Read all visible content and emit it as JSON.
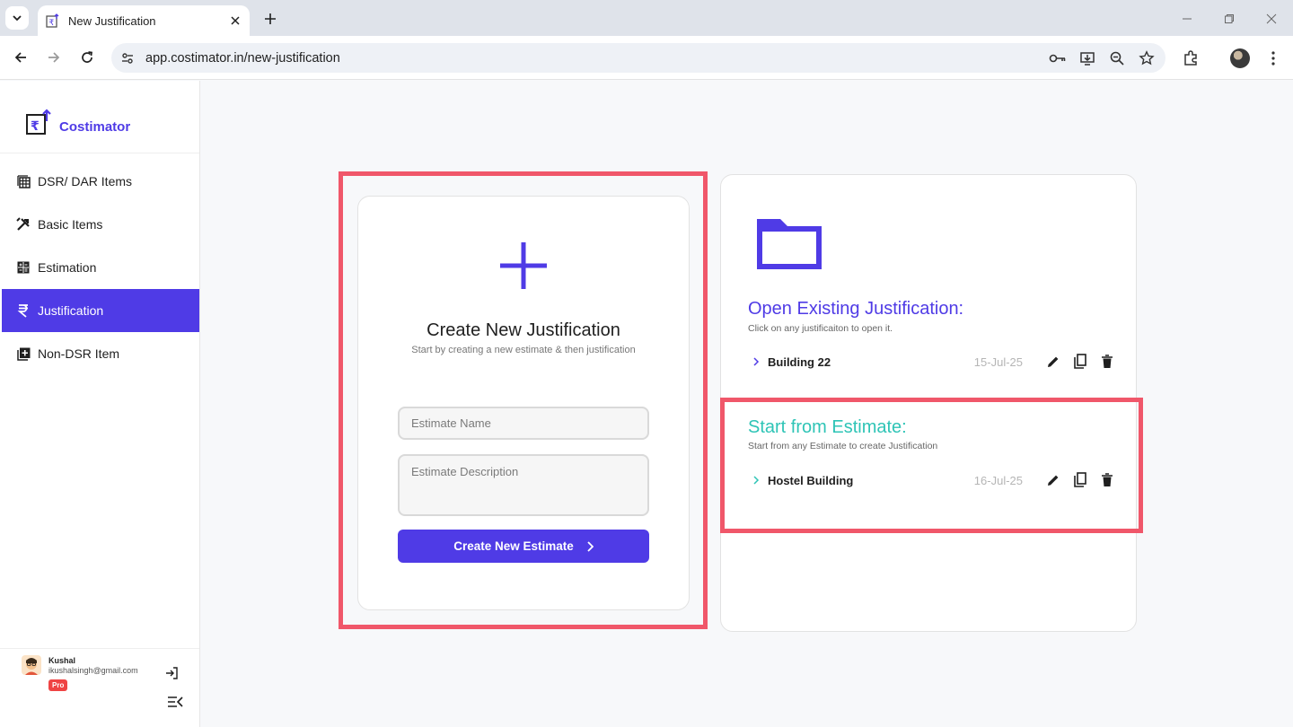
{
  "browser": {
    "tab_title": "New Justification",
    "url": "app.costimator.in/new-justification"
  },
  "sidebar": {
    "brand": "Costimator",
    "items": [
      {
        "label": "DSR/ DAR Items",
        "icon": "table-grid-icon"
      },
      {
        "label": "Basic Items",
        "icon": "tools-icon"
      },
      {
        "label": "Estimation",
        "icon": "calculator-icon"
      },
      {
        "label": "Justification",
        "icon": "rupee-icon",
        "active": true
      },
      {
        "label": "Non-DSR Item",
        "icon": "add-box-icon"
      }
    ],
    "user": {
      "name": "Kushal",
      "email": "ikushalsingh@gmail.com",
      "badge": "Pro"
    }
  },
  "create": {
    "title": "Create New Justification",
    "subtitle": "Start by creating a new estimate & then justification",
    "name_placeholder": "Estimate Name",
    "description_placeholder": "Estimate Description",
    "button_label": "Create New Estimate"
  },
  "existing": {
    "title": "Open Existing Justification:",
    "subtitle": "Click on any justificaiton to open it.",
    "items": [
      {
        "name": "Building 22",
        "date": "15-Jul-25"
      }
    ]
  },
  "from_estimate": {
    "title": "Start from Estimate:",
    "subtitle": "Start from any Estimate to create Justification",
    "items": [
      {
        "name": "Hostel Building",
        "date": "16-Jul-25"
      }
    ]
  },
  "colors": {
    "accent": "#4f3be6",
    "teal": "#2ec4b6",
    "highlight": "#f0576a"
  }
}
